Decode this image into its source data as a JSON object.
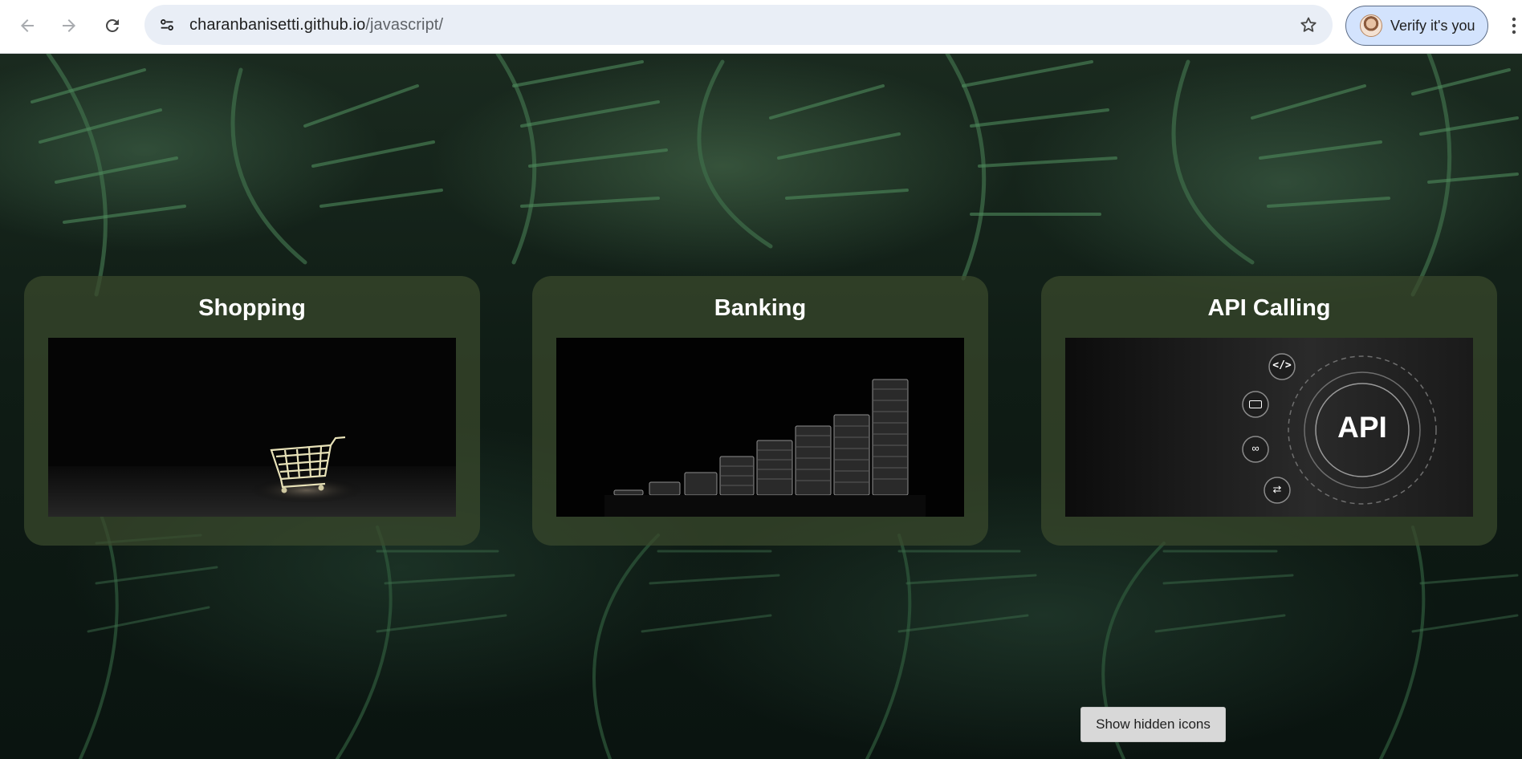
{
  "browser": {
    "url_domain": "charanbanisetti.github.io",
    "url_path": "/javascript/",
    "profile_button_label": "Verify it's you"
  },
  "cards": [
    {
      "title": "Shopping",
      "image": "shopping-cart-image"
    },
    {
      "title": "Banking",
      "image": "coin-stacks-image"
    },
    {
      "title": "API Calling",
      "image": "api-image",
      "image_text": "API"
    }
  ],
  "taskbar": {
    "show_hidden_icons_label": "Show hidden icons"
  },
  "colors": {
    "card_bg": "#3a4a2c",
    "omnibox_bg": "#e9eef6",
    "verify_bg": "#d3e3fd"
  }
}
